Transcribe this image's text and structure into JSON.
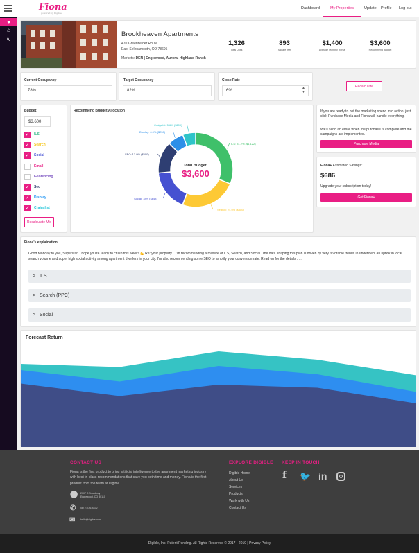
{
  "header": {
    "logo": "Fiona",
    "logo_sub": "powered by Digible",
    "nav": [
      "Dashboard",
      "My Properties",
      "Update",
      "Profile",
      "Log out"
    ]
  },
  "property": {
    "name": "Brookheaven Apartments",
    "address1": "470 Greenfielder Route",
    "address2": "East Selenamouth, CO 78695",
    "markets_label": "Markets:",
    "markets": "DEN | Englewood, Aurora, Highland Ranch"
  },
  "stats": [
    {
      "value": "1,326",
      "label": "Total Units"
    },
    {
      "value": "893",
      "label": "Square feet"
    },
    {
      "value": "$1,400",
      "label": "Average Monthly Rental"
    },
    {
      "value": "$3,600",
      "label": "Recommend Budget"
    }
  ],
  "occupancy": {
    "current_label": "Current Occupancy",
    "current_value": "78%",
    "target_label": "Target Occupancy",
    "target_value": "82%",
    "close_label": "Close Rate",
    "close_value": "6%",
    "recalc": "Recalculate"
  },
  "budget": {
    "label": "Budget:",
    "value": "$3,600",
    "recalc_mix": "Recalculate Mix",
    "items": [
      {
        "label": "ILS",
        "checked": true,
        "color": "#3fbf8f"
      },
      {
        "label": "Search",
        "checked": true,
        "color": "#f5c518"
      },
      {
        "label": "Social",
        "checked": true,
        "color": "#4a56d6"
      },
      {
        "label": "Email",
        "checked": false,
        "color": "#e91e84"
      },
      {
        "label": "Geofencing",
        "checked": false,
        "color": "#7e57c2"
      },
      {
        "label": "Seo",
        "checked": true,
        "color": "#2e3f6e"
      },
      {
        "label": "Display",
        "checked": true,
        "color": "#2196f3"
      },
      {
        "label": "Craigslist",
        "checked": true,
        "color": "#26c6da"
      }
    ]
  },
  "allocation": {
    "title": "Recommend Budget Allocation",
    "center_label": "Total Budget:",
    "center_value": "$3,600"
  },
  "chart_data": [
    {
      "type": "pie",
      "title": "Recommend Budget Allocation",
      "slices": [
        {
          "name": "ILS",
          "percent": 31.2,
          "value": 1122,
          "label": "ILS: 31.2% ($1,122)",
          "color": "#3fc06a"
        },
        {
          "name": "Search",
          "percent": 24.6,
          "value": 886,
          "label": "Search: 24.6% ($886)",
          "color": "#fdc935"
        },
        {
          "name": "Social",
          "percent": 18,
          "value": 648,
          "label": "Social: 18% ($648)",
          "color": "#4651d1"
        },
        {
          "name": "SEO",
          "percent": 13.9,
          "value": 500,
          "label": "SEO: 13.9% ($500)",
          "color": "#2e3e72"
        },
        {
          "name": "Display",
          "percent": 6.9,
          "value": 250,
          "label": "Display: 6.9% ($250)",
          "color": "#2d8fe8"
        },
        {
          "name": "Craigslist",
          "percent": 5.6,
          "value": 200,
          "label": "Craigslist: 5.6% ($200)",
          "color": "#2fc4c9"
        }
      ]
    },
    {
      "type": "area",
      "title": "Forecast Return",
      "x": [
        0,
        1,
        2,
        3,
        4
      ],
      "series": [
        {
          "values": [
            80,
            77,
            92,
            84,
            69
          ],
          "color": "#36c3c4"
        },
        {
          "values": [
            74,
            63,
            78,
            70,
            53
          ],
          "color": "#2e8ef0"
        },
        {
          "values": [
            61,
            49,
            60,
            57,
            42
          ],
          "color": "#3f4d87"
        }
      ],
      "ylim": [
        0,
        100
      ]
    }
  ],
  "purchase": {
    "text1": "If you are ready to put the marketing spend into action, just click Purchase Media and Fiona will handle everything.",
    "text2": "We'll send an email when the purchase is complete and the campaigns are implemented.",
    "button": "Purchase Media"
  },
  "savings": {
    "label_bold": "Fiona+",
    "label": " Estimated Savings:",
    "value": "$686",
    "text": "Upgrade your subscription today!",
    "button": "Get Fiona+"
  },
  "explanation": {
    "title": "Fiona's explaination",
    "text": "Good Monday to you, Superstar! I hope you're ready to crush this week! 💪 Re: your property... I'm recommending a mixture of ILS, Search, and Social. The data shaping this plan is driven by very favorable trends in undefined, an uptick in local search volume and super high social activity among apartment dwellers in your city. I'm also recommending some SEO to amplify your conversion rate. Read on for the details . . .",
    "accordions": [
      "ILS",
      "Search (PPC)",
      "Social"
    ]
  },
  "forecast": {
    "title": "Forecast Return"
  },
  "footer": {
    "contact_title": "CONTACT US",
    "contact_text": "Fiona is the first product to bring artificial intelligence to the apartment marketing industry with best-in-class recommendations that save you both time and money. Fiona is the first product from the team at Digible.",
    "address1": "2007 S Broadway",
    "address2": "Englewood, CO 80110",
    "phone": "(877) 726-4432",
    "email": "hello@digible.com",
    "explore_title": "EXPLORE DIGIBLE",
    "links": [
      "Digible Home",
      "About Us",
      "Services",
      "Products",
      "Work with Us",
      "Contact Us"
    ],
    "keep_title": "KEEP IN TOUCH",
    "copyright": "Digible, Inc. Patent Pending. All Rights Reserved © 2017 - 2019  |  Privacy Policy"
  }
}
